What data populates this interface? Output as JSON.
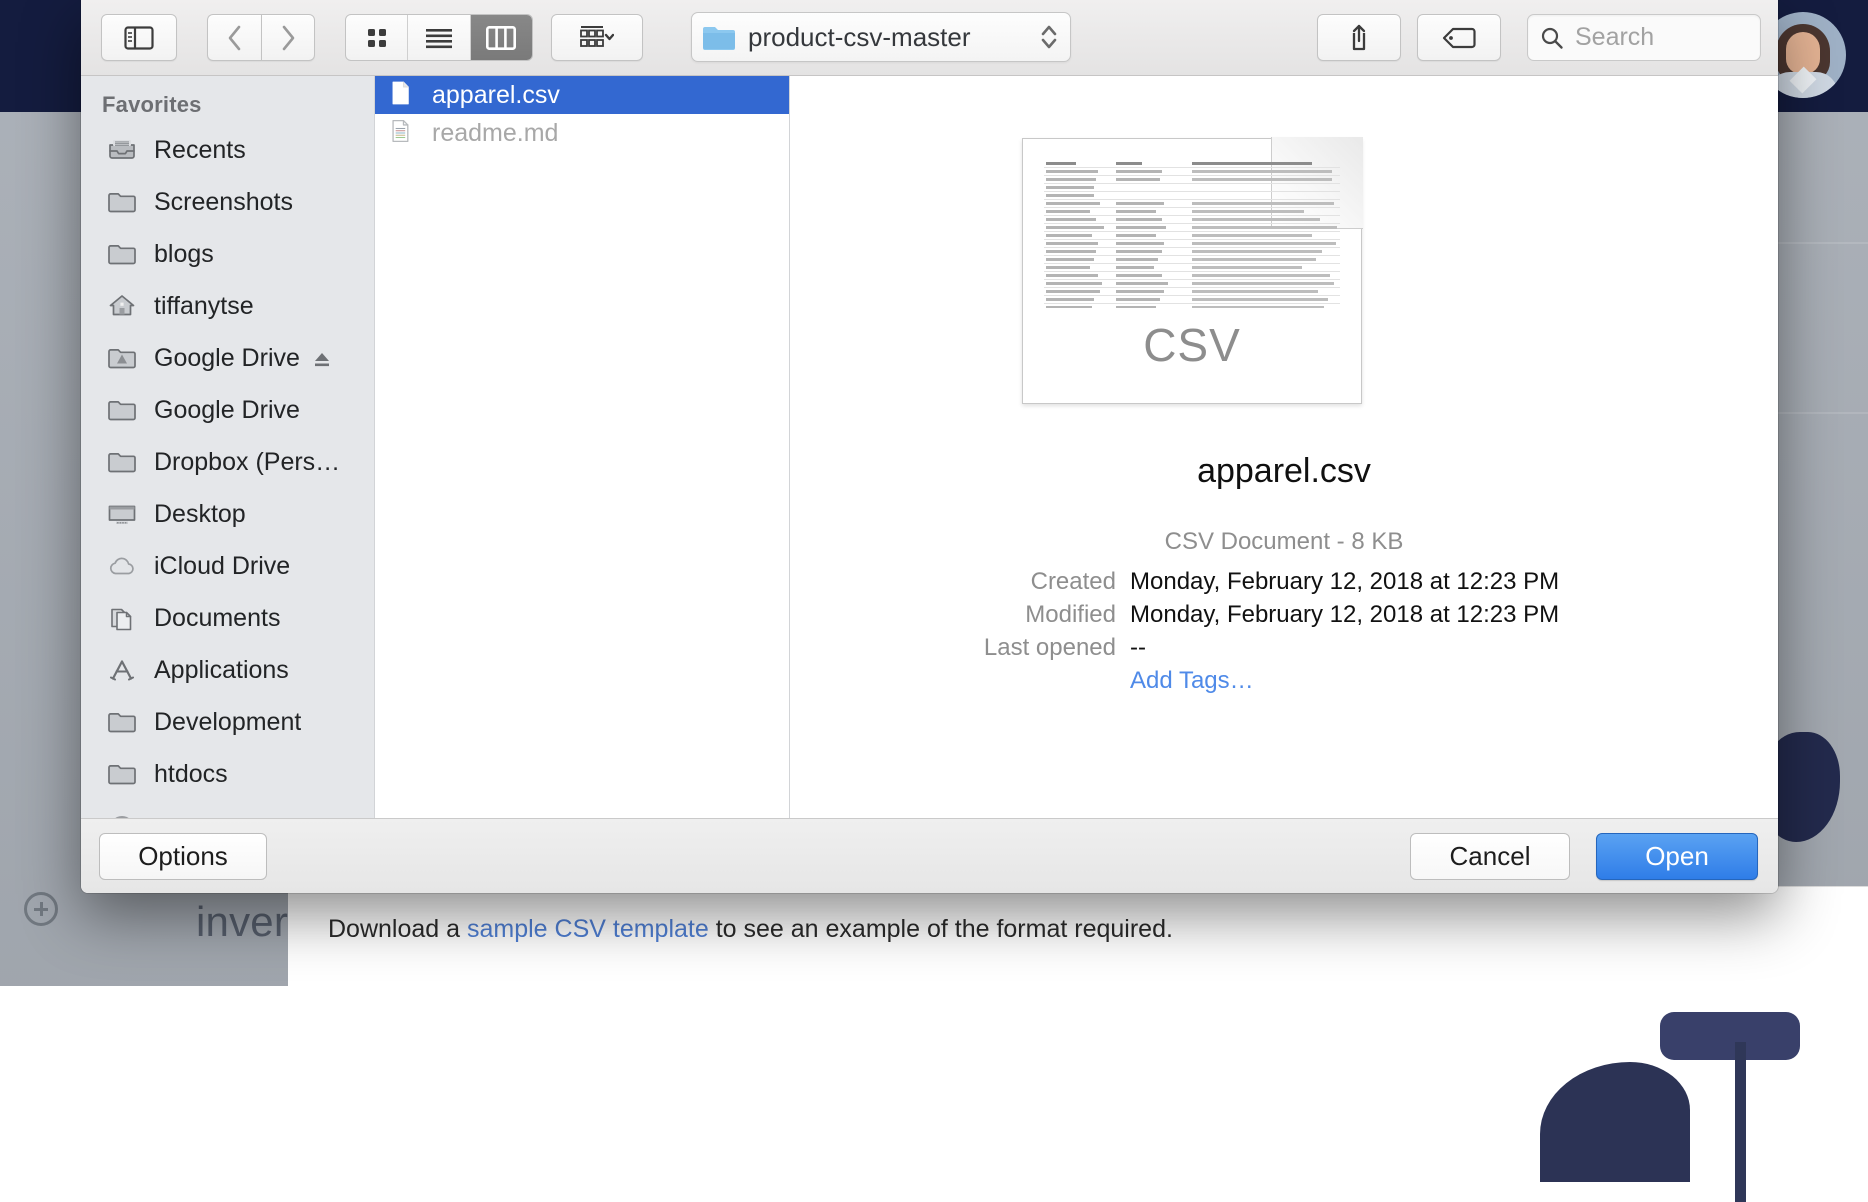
{
  "background": {
    "word_fragment": "inver",
    "note_prefix": "Download a ",
    "note_link": "sample CSV template",
    "note_suffix": " to see an example of the format required.",
    "navbar_color": "#141c3f",
    "avatar_name": "user-avatar"
  },
  "toolbar": {
    "sidebar_toggle": "sidebar-toggle",
    "back": "back",
    "forward": "forward",
    "views": [
      {
        "name": "icon-view",
        "active": false
      },
      {
        "name": "list-view",
        "active": false
      },
      {
        "name": "column-view",
        "active": true
      }
    ],
    "arrange": "arrange-by",
    "path_label": "product-csv-master",
    "share": "share",
    "tags": "tags",
    "search_placeholder": "Search"
  },
  "sidebar": {
    "heading": "Favorites",
    "items": [
      {
        "label": "Recents",
        "icon": "recents-icon",
        "eject": false
      },
      {
        "label": "Screenshots",
        "icon": "folder-icon",
        "eject": false
      },
      {
        "label": "blogs",
        "icon": "folder-icon",
        "eject": false
      },
      {
        "label": "tiffanytse",
        "icon": "home-icon",
        "eject": false
      },
      {
        "label": "Google Drive",
        "icon": "google-drive-icon",
        "eject": true
      },
      {
        "label": "Google Drive",
        "icon": "folder-icon",
        "eject": false
      },
      {
        "label": "Dropbox (Pers…",
        "icon": "folder-icon",
        "eject": false
      },
      {
        "label": "Desktop",
        "icon": "desktop-icon",
        "eject": false
      },
      {
        "label": "iCloud Drive",
        "icon": "cloud-icon",
        "eject": false
      },
      {
        "label": "Documents",
        "icon": "documents-icon",
        "eject": false
      },
      {
        "label": "Applications",
        "icon": "applications-icon",
        "eject": false
      },
      {
        "label": "Development",
        "icon": "folder-icon",
        "eject": false
      },
      {
        "label": "htdocs",
        "icon": "folder-icon",
        "eject": false
      },
      {
        "label": "",
        "icon": "downloads-icon",
        "eject": false
      }
    ]
  },
  "filelist": {
    "files": [
      {
        "name": "apparel.csv",
        "icon": "csv-file-icon",
        "selected": true
      },
      {
        "name": "readme.md",
        "icon": "markdown-file-icon",
        "selected": false
      }
    ]
  },
  "preview": {
    "thumbnail_label": "CSV",
    "filename": "apparel.csv",
    "kind": "CSV Document - 8 KB",
    "meta": [
      {
        "key": "Created",
        "value": "Monday, February 12, 2018 at 12:23 PM",
        "link": false
      },
      {
        "key": "Modified",
        "value": "Monday, February 12, 2018 at 12:23 PM",
        "link": false
      },
      {
        "key": "Last opened",
        "value": "--",
        "link": false
      },
      {
        "key": "",
        "value": "Add Tags…",
        "link": true
      }
    ]
  },
  "footer": {
    "options_label": "Options",
    "cancel_label": "Cancel",
    "open_label": "Open"
  },
  "colors": {
    "selection_blue": "#3368d1",
    "default_button_blue": "#2f7de8",
    "link_blue": "#4f8ae8"
  }
}
